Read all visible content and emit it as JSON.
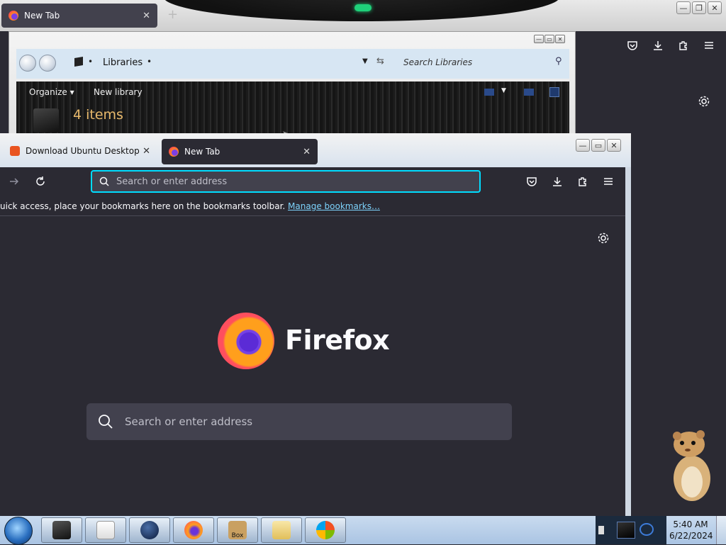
{
  "back_window": {
    "tab_title": "New Tab",
    "tab_close": "✕",
    "new_tab": "+",
    "controls": [
      "—",
      "❐",
      "✕"
    ]
  },
  "explorer": {
    "path": "Libraries",
    "search_placeholder": "Search Libraries",
    "organize": "Organize ▾",
    "new_library": "New library",
    "item_count": "4 items",
    "controls": [
      "—",
      "▭",
      "✕"
    ]
  },
  "front_window": {
    "tabs": [
      {
        "title": "Download Ubuntu Desktop | Ubuntu",
        "icon": "ubuntu-icon",
        "close": "✕"
      },
      {
        "title": "New Tab",
        "icon": "firefox-icon",
        "close": "✕"
      }
    ],
    "controls": [
      "—",
      "▭",
      "✕"
    ],
    "urlbar_placeholder": "Search or enter address",
    "bookmarks_text": "uick access, place your bookmarks here on the bookmarks toolbar.",
    "bookmarks_link": "Manage bookmarks…",
    "brand": "Firefox",
    "search_placeholder": "Search or enter address"
  },
  "taskbar": {
    "apps": [
      "explorer-box",
      "media-player",
      "globe",
      "firefox",
      "hamster-box",
      "folder",
      "windows-logo"
    ],
    "hamster_box_label": "Box",
    "time": "5:40 AM",
    "date": "6/22/2024"
  },
  "colors": {
    "ff_dark": "#2b2a33",
    "ff_field": "#42414e",
    "focus_ring": "#00ddff",
    "explorer_items": "#e8b96c"
  }
}
